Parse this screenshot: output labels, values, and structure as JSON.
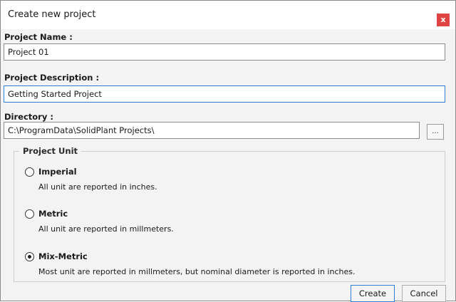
{
  "dialog": {
    "title": "Create new project",
    "close_label": "x"
  },
  "fields": {
    "name_label": "Project Name :",
    "name_value": "Project 01",
    "description_label": "Project Description :",
    "description_value": "Getting Started Project",
    "directory_label": "Directory :",
    "directory_value": "C:\\ProgramData\\SolidPlant Projects\\",
    "browse_label": "..."
  },
  "project_unit": {
    "group_title": "Project Unit",
    "selected": "Mix-Metric",
    "options": [
      {
        "label": "Imperial",
        "description": "All unit are reported in inches."
      },
      {
        "label": "Metric",
        "description": "All unit are reported in millmeters."
      },
      {
        "label": "Mix-Metric",
        "description": "Most unit are reported in millmeters, but nominal diameter is reported in inches."
      }
    ]
  },
  "buttons": {
    "create": "Create",
    "cancel": "Cancel"
  },
  "colors": {
    "close_button": "#e04343",
    "focus_border": "#2d7fd2"
  }
}
